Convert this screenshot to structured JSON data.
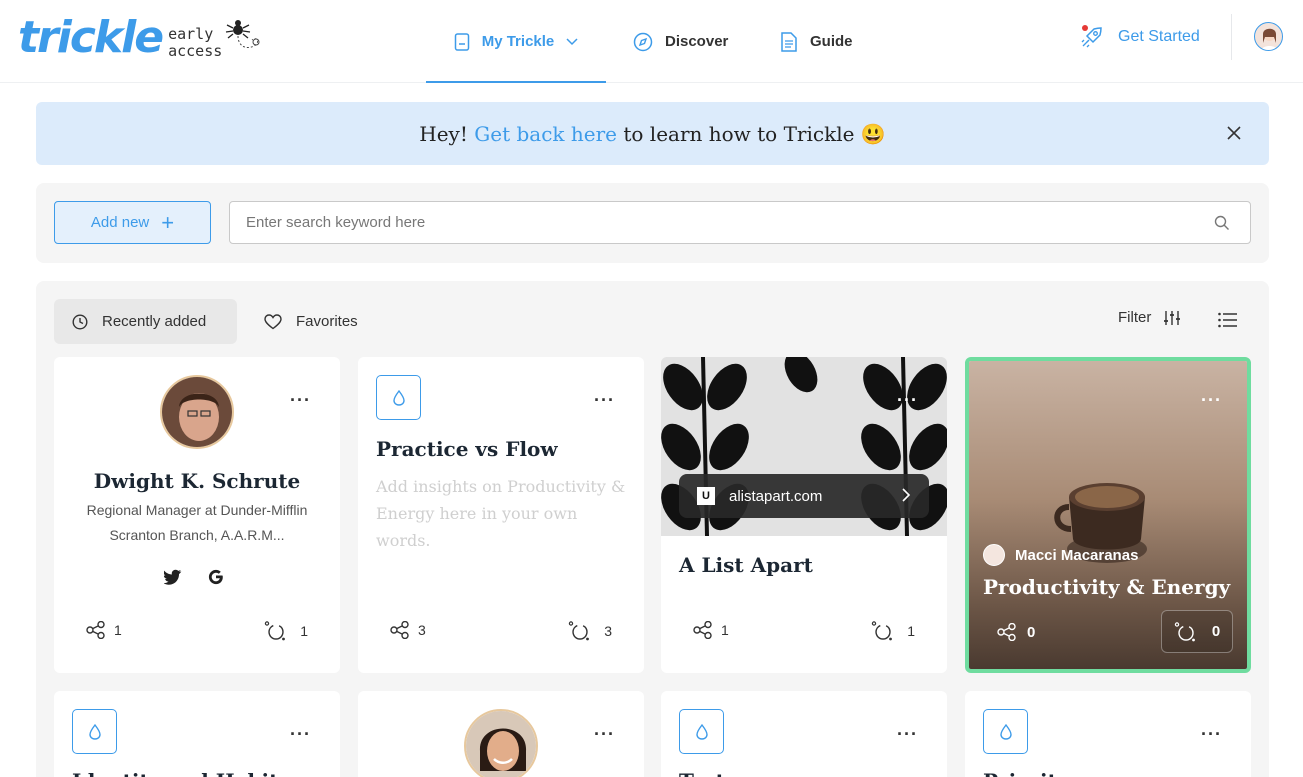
{
  "brand": {
    "logo_word": "trickle",
    "logo_sub_line1": "early",
    "logo_sub_line2": "access"
  },
  "nav": {
    "my_trickle": "My Trickle",
    "discover": "Discover",
    "guide": "Guide",
    "get_started": "Get Started"
  },
  "banner": {
    "lead": "Hey! ",
    "link": "Get back here",
    "tail": " to learn how to Trickle ",
    "emoji": "😃"
  },
  "toolbar": {
    "add_new": "Add new",
    "add_symbol": "+",
    "search_placeholder": "Enter search keyword here"
  },
  "tabs": {
    "recently_added": "Recently added",
    "favorites": "Favorites",
    "filter": "Filter"
  },
  "cards": [
    {
      "type": "person",
      "name": "Dwight K. Schrute",
      "description": "Regional Manager at Dunder-Mifflin Scranton Branch, A.A.R.M...",
      "share_count": "1",
      "trickle_count": "1"
    },
    {
      "type": "note",
      "title": "Practice vs Flow",
      "placeholder": "Add insights on Productivity & Energy here in your own words.",
      "share_count": "3",
      "trickle_count": "3"
    },
    {
      "type": "link",
      "domain": "alistapart.com",
      "title": "A List Apart",
      "share_count": "1",
      "trickle_count": "1"
    },
    {
      "type": "featured",
      "author": "Macci Macaranas",
      "title": "Productivity & Energy",
      "share_count": "0",
      "trickle_count": "0"
    }
  ],
  "row2": [
    {
      "title": "Identity and Habits"
    },
    {
      "title": ""
    },
    {
      "title": "Test"
    },
    {
      "title": "Priority"
    }
  ],
  "colors": {
    "accent": "#3d9be9",
    "banner_bg": "#dcebfb",
    "panel_bg": "#f5f5f5",
    "feature_border": "#6fdc9f"
  }
}
